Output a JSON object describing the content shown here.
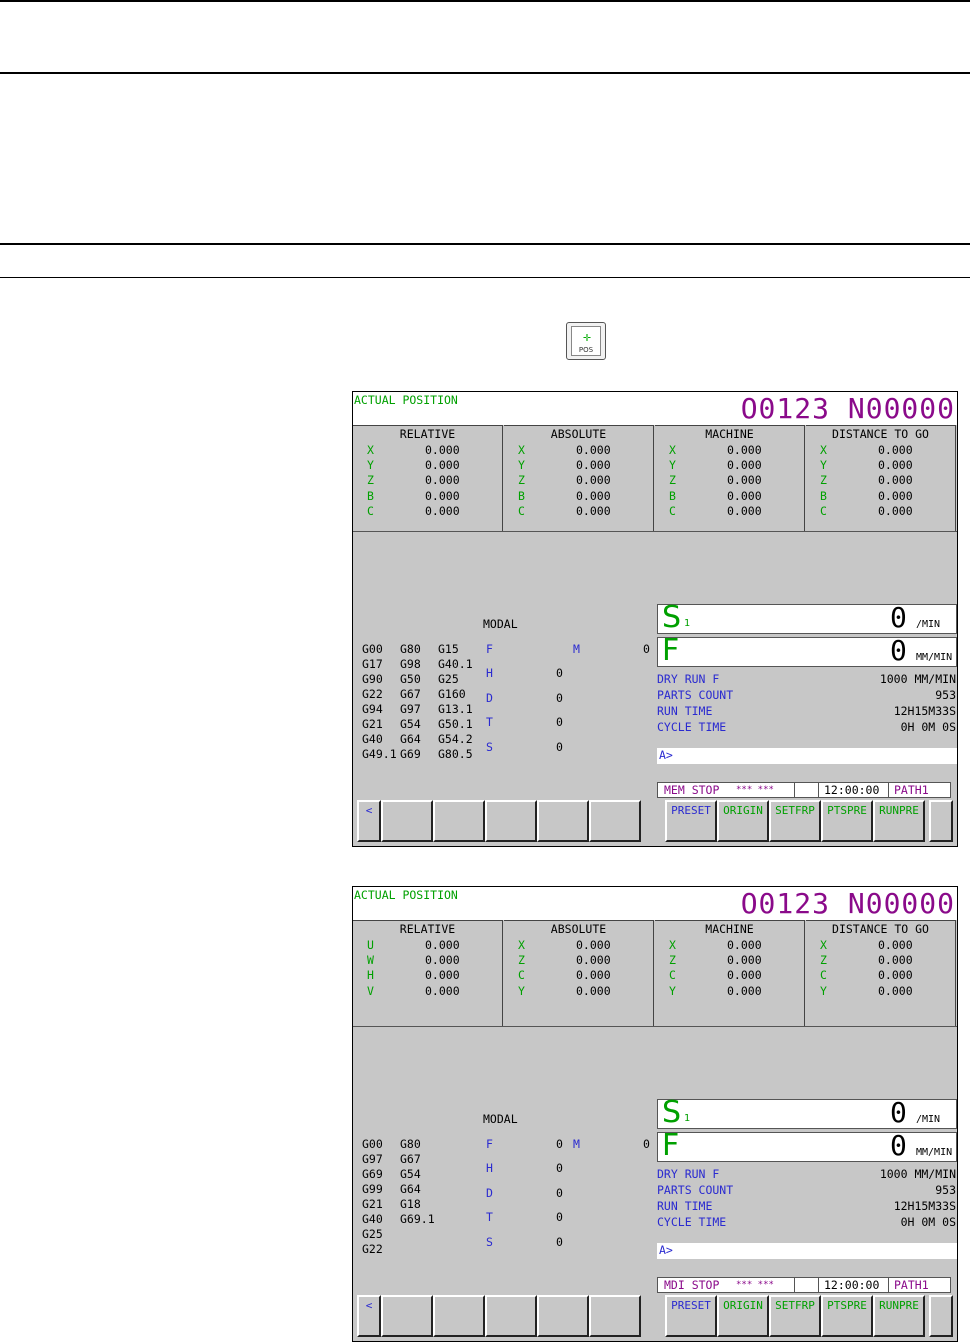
{
  "key_label": "POS",
  "screen1": {
    "title": "ACTUAL POSITION",
    "program": "O0123 N00000",
    "panels": [
      {
        "header": "RELATIVE",
        "rows": [
          [
            "X",
            "0.000"
          ],
          [
            "Y",
            "0.000"
          ],
          [
            "Z",
            "0.000"
          ],
          [
            "B",
            "0.000"
          ],
          [
            "C",
            "0.000"
          ]
        ]
      },
      {
        "header": "ABSOLUTE",
        "rows": [
          [
            "X",
            "0.000"
          ],
          [
            "Y",
            "0.000"
          ],
          [
            "Z",
            "0.000"
          ],
          [
            "B",
            "0.000"
          ],
          [
            "C",
            "0.000"
          ]
        ]
      },
      {
        "header": "MACHINE",
        "rows": [
          [
            "X",
            "0.000"
          ],
          [
            "Y",
            "0.000"
          ],
          [
            "Z",
            "0.000"
          ],
          [
            "B",
            "0.000"
          ],
          [
            "C",
            "0.000"
          ]
        ]
      },
      {
        "header": "DISTANCE TO GO",
        "rows": [
          [
            "X",
            "0.000"
          ],
          [
            "Y",
            "0.000"
          ],
          [
            "Z",
            "0.000"
          ],
          [
            "B",
            "0.000"
          ],
          [
            "C",
            "0.000"
          ]
        ]
      }
    ],
    "modal_header": "MODAL",
    "gcodes": [
      [
        "G00",
        "G80",
        "G15"
      ],
      [
        "G17",
        "G98",
        "G40.1"
      ],
      [
        "G90",
        "G50",
        "G25"
      ],
      [
        "G22",
        "G67",
        "G160"
      ],
      [
        "G94",
        "G97",
        "G13.1"
      ],
      [
        "G21",
        "G54",
        "G50.1"
      ],
      [
        "G40",
        "G64",
        "G54.2"
      ],
      [
        "G49.1",
        "G69",
        "G80.5"
      ]
    ],
    "modal_f": {
      "label": "F",
      "value": ""
    },
    "modal_m": {
      "label": "M",
      "value": "0"
    },
    "modal_vals": [
      [
        "H",
        "0"
      ],
      [
        "D",
        "0"
      ],
      [
        "T",
        "0"
      ],
      [
        "S",
        "0"
      ]
    ],
    "s": {
      "letter": "S",
      "sub": "1",
      "value": "0",
      "unit": "/MIN"
    },
    "f": {
      "letter": "F",
      "value": "0",
      "unit": "MM/MIN"
    },
    "info": [
      {
        "label": "DRY RUN F",
        "value": "1000 MM/MIN"
      },
      {
        "label": "PARTS COUNT",
        "value": "953"
      },
      {
        "label": "RUN TIME",
        "value": "12H15M33S"
      },
      {
        "label": "CYCLE TIME",
        "value": "0H 0M 0S"
      }
    ],
    "prompt": "A>",
    "status": {
      "mode": "MEM  STOP",
      "alarm": "*** ***",
      "time": "12:00:00",
      "path": "PATH1"
    },
    "softkeys": [
      "<",
      "",
      "",
      "",
      "",
      "",
      "PRESET",
      "ORIGIN",
      "SETFRP",
      "PTSPRE",
      "RUNPRE",
      ""
    ]
  },
  "screen2": {
    "title": "ACTUAL POSITION",
    "program": "O0123 N00000",
    "panels": [
      {
        "header": "RELATIVE",
        "rows": [
          [
            "U",
            "0.000"
          ],
          [
            "W",
            "0.000"
          ],
          [
            "H",
            "0.000"
          ],
          [
            "V",
            "0.000"
          ]
        ]
      },
      {
        "header": "ABSOLUTE",
        "rows": [
          [
            "X",
            "0.000"
          ],
          [
            "Z",
            "0.000"
          ],
          [
            "C",
            "0.000"
          ],
          [
            "Y",
            "0.000"
          ]
        ]
      },
      {
        "header": "MACHINE",
        "rows": [
          [
            "X",
            "0.000"
          ],
          [
            "Z",
            "0.000"
          ],
          [
            "C",
            "0.000"
          ],
          [
            "Y",
            "0.000"
          ]
        ]
      },
      {
        "header": "DISTANCE TO GO",
        "rows": [
          [
            "X",
            "0.000"
          ],
          [
            "Z",
            "0.000"
          ],
          [
            "C",
            "0.000"
          ],
          [
            "Y",
            "0.000"
          ]
        ]
      }
    ],
    "modal_header": "MODAL",
    "gcodes": [
      [
        "G00",
        "G80",
        ""
      ],
      [
        "G97",
        "G67",
        ""
      ],
      [
        "G69",
        "G54",
        ""
      ],
      [
        "G99",
        "G64",
        ""
      ],
      [
        "G21",
        "G18",
        ""
      ],
      [
        "G40",
        "G69.1",
        ""
      ],
      [
        "G25",
        "",
        ""
      ],
      [
        "G22",
        "",
        ""
      ]
    ],
    "modal_f": {
      "label": "F",
      "value": "0"
    },
    "modal_m": {
      "label": "M",
      "value": "0"
    },
    "modal_vals": [
      [
        "H",
        "0"
      ],
      [
        "D",
        "0"
      ],
      [
        "T",
        "0"
      ],
      [
        "S",
        "0"
      ]
    ],
    "s": {
      "letter": "S",
      "sub": "1",
      "value": "0",
      "unit": "/MIN"
    },
    "f": {
      "letter": "F",
      "value": "0",
      "unit": "MM/MIN"
    },
    "info": [
      {
        "label": "DRY RUN F",
        "value": "1000 MM/MIN"
      },
      {
        "label": "PARTS COUNT",
        "value": "953"
      },
      {
        "label": "RUN TIME",
        "value": "12H15M33S"
      },
      {
        "label": "CYCLE TIME",
        "value": "0H 0M 0S"
      }
    ],
    "prompt": "A>",
    "status": {
      "mode": "MDI  STOP",
      "alarm": "*** ***",
      "time": "12:00:00",
      "path": "PATH1"
    },
    "softkeys": [
      "<",
      "",
      "",
      "",
      "",
      "",
      "PRESET",
      "ORIGIN",
      "SETFRP",
      "PTSPRE",
      "RUNPRE",
      ""
    ]
  }
}
